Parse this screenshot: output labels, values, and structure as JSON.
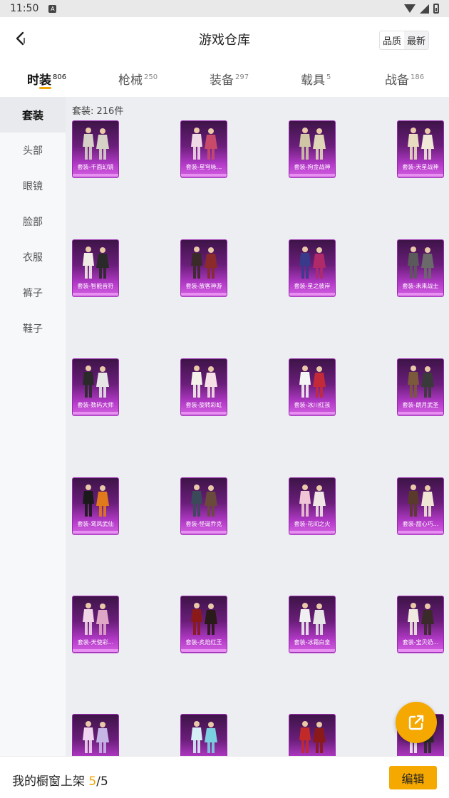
{
  "status_bar": {
    "time": "11:50",
    "app_icon": "A"
  },
  "header": {
    "title": "游戏仓库",
    "sort_options": [
      "品质",
      "最新"
    ]
  },
  "tabs": [
    {
      "label": "时装",
      "count": "806"
    },
    {
      "label": "枪械",
      "count": "250"
    },
    {
      "label": "装备",
      "count": "297"
    },
    {
      "label": "载具",
      "count": "5"
    },
    {
      "label": "战备",
      "count": "186"
    }
  ],
  "sidebar": {
    "items": [
      "套装",
      "头部",
      "眼镜",
      "脸部",
      "衣服",
      "裤子",
      "鞋子"
    ]
  },
  "content": {
    "count_label": "套装: 216件",
    "items": [
      {
        "name": "套装-千面幻镜",
        "colors": [
          "#d6d2c8",
          "#d6d2c8"
        ]
      },
      {
        "name": "套装-星穹咏...",
        "colors": [
          "#f0d9e6",
          "#c84a6a"
        ]
      },
      {
        "name": "套装-拘金战神",
        "colors": [
          "#cfc6a6",
          "#e0d6b8"
        ]
      },
      {
        "name": "套装-天星战神",
        "colors": [
          "#e8dcc0",
          "#f0e8d8"
        ]
      },
      {
        "name": "套装-智能音符",
        "colors": [
          "#f0ece6",
          "#2a2a2a"
        ]
      },
      {
        "name": "套装-放客神游",
        "colors": [
          "#3a2a2a",
          "#8a2a2a"
        ]
      },
      {
        "name": "套装-星之彼岸",
        "colors": [
          "#3a3a8a",
          "#b02a6a"
        ]
      },
      {
        "name": "套装-未来战士",
        "colors": [
          "#5a5a5a",
          "#6a6a6a"
        ]
      },
      {
        "name": "套装-数码大师",
        "colors": [
          "#2a2a2a",
          "#e6e6e6"
        ]
      },
      {
        "name": "套装-旋转彩虹",
        "colors": [
          "#f4f0ea",
          "#f4e0e6"
        ]
      },
      {
        "name": "套装-冰川红孩",
        "colors": [
          "#f4f4f4",
          "#c22a3a"
        ]
      },
      {
        "name": "套装-朗月武圣",
        "colors": [
          "#7a5a3a",
          "#3a3a3a"
        ]
      },
      {
        "name": "套装-鸾凤武仙",
        "colors": [
          "#1a1a1a",
          "#e07a1a"
        ]
      },
      {
        "name": "套装-怪诞乔克",
        "colors": [
          "#3a4a5a",
          "#6a4a3a"
        ]
      },
      {
        "name": "套装-花间之火",
        "colors": [
          "#f0c6d6",
          "#f0e6e6"
        ]
      },
      {
        "name": "套装-甜心巧...",
        "colors": [
          "#5a3a2a",
          "#f0e6d6"
        ]
      },
      {
        "name": "套装-天使彩...",
        "colors": [
          "#f0d6e6",
          "#e0a6c6"
        ]
      },
      {
        "name": "套装-炙焰红王",
        "colors": [
          "#8a1a1a",
          "#2a1a1a"
        ]
      },
      {
        "name": "套装-冰霜白皇",
        "colors": [
          "#f0f0f0",
          "#e6e6e6"
        ]
      },
      {
        "name": "套装-宝贝奶...",
        "colors": [
          "#f0eae0",
          "#3a2a2a"
        ]
      },
      {
        "name": "",
        "colors": [
          "#f0d6f0",
          "#c6b6e6"
        ]
      },
      {
        "name": "",
        "colors": [
          "#d6eef6",
          "#7ad0e0"
        ]
      },
      {
        "name": "",
        "colors": [
          "#c22a2a",
          "#8a1a1a"
        ]
      },
      {
        "name": "",
        "colors": [
          "#f0f0f0",
          "#2a2a2a"
        ]
      }
    ]
  },
  "bottom_bar": {
    "label_prefix": "我的橱窗上架 ",
    "shown": "5",
    "separator": "/",
    "total": "5",
    "edit_label": "编辑"
  },
  "colors": {
    "accent": "#f5a800",
    "card_purple": "#6a1e7a"
  }
}
